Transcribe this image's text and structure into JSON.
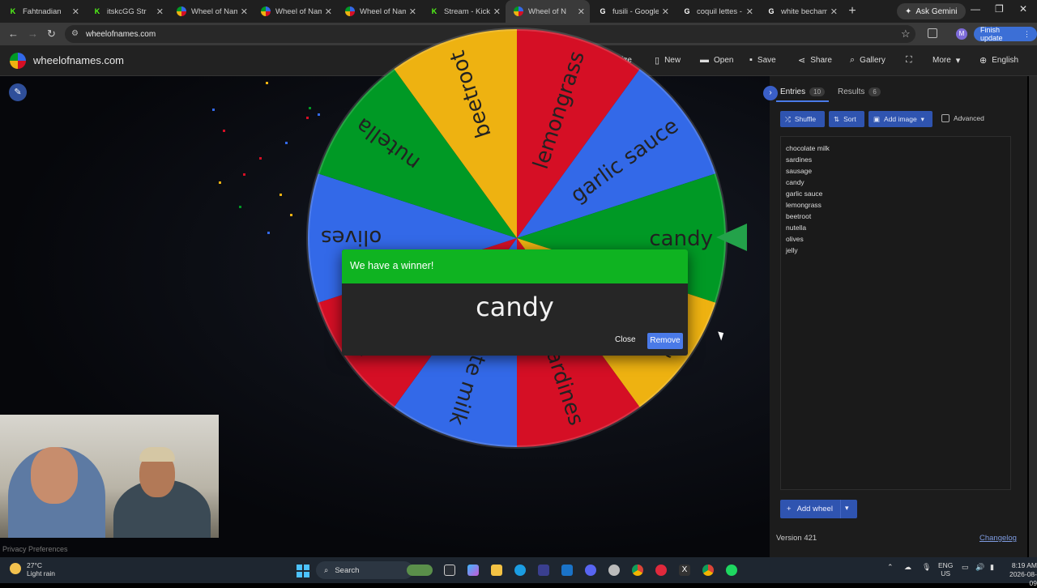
{
  "tabs": [
    {
      "title": "Fahtnadian",
      "fav_color": "#53fc18",
      "fav_text": "K"
    },
    {
      "title": "itskcGG Str",
      "fav_color": "#53fc18",
      "fav_text": "K"
    },
    {
      "title": "Wheel of Name",
      "fav_color": "#e24",
      "fav_text": ""
    },
    {
      "title": "Wheel of Name",
      "fav_color": "#e24",
      "fav_text": ""
    },
    {
      "title": "Wheel of Name",
      "fav_color": "#e24",
      "fav_text": ""
    },
    {
      "title": "Stream - Kick D",
      "fav_color": "#53fc18",
      "fav_text": "K"
    },
    {
      "title": "Wheel of N",
      "fav_color": "#e24",
      "fav_text": ""
    },
    {
      "title": "fusili - Google",
      "fav_color": "#fff",
      "fav_text": "G"
    },
    {
      "title": "coquil lettes - G",
      "fav_color": "#fff",
      "fav_text": "G"
    },
    {
      "title": "white becham",
      "fav_color": "#fff",
      "fav_text": "G"
    }
  ],
  "browser": {
    "ask_gemini": "Ask Gemini",
    "url": "wheelofnames.com",
    "profile_initial": "M",
    "finish_update": "Finish update"
  },
  "app": {
    "site_name": "wheelofnames.com",
    "menu": [
      {
        "label": "Customize",
        "icon": "palette-icon",
        "glyph": "◕"
      },
      {
        "label": "New",
        "icon": "new-file-icon",
        "glyph": "▯"
      },
      {
        "label": "Open",
        "icon": "folder-icon",
        "glyph": "▬"
      },
      {
        "label": "Save",
        "icon": "save-icon",
        "glyph": "▪"
      },
      {
        "label": "Share",
        "icon": "share-icon",
        "glyph": "⋖"
      },
      {
        "label": "Gallery",
        "icon": "search-icon",
        "glyph": "⌕"
      },
      {
        "label": "",
        "icon": "fullscreen-icon",
        "glyph": "⛶"
      },
      {
        "label": "More",
        "icon": "chevron-down-icon",
        "glyph": "▾"
      },
      {
        "label": "English",
        "icon": "globe-icon",
        "glyph": "⊕"
      }
    ]
  },
  "wheel": {
    "segments": [
      {
        "label": "beetroot",
        "color": "#eeb211"
      },
      {
        "label": "lemongrass",
        "color": "#d50f25"
      },
      {
        "label": "garlic sauce",
        "color": "#3369e8"
      },
      {
        "label": "candy",
        "color": "#009925"
      },
      {
        "label": "sausage",
        "color": "#eeb211"
      },
      {
        "label": "sardines",
        "color": "#d50f25"
      },
      {
        "label": "chocolate milk",
        "color": "#3369e8"
      },
      {
        "label": "jelly",
        "color": "#d50f25"
      },
      {
        "label": "olives",
        "color": "#3369e8"
      },
      {
        "label": "nutella",
        "color": "#009925"
      }
    ]
  },
  "dialog": {
    "title": "We have a winner!",
    "winner": "candy",
    "close_label": "Close",
    "remove_label": "Remove"
  },
  "privacy": "Privacy Preferences",
  "panel": {
    "tab_entries": "Entries",
    "entries_count": "10",
    "tab_results": "Results",
    "results_count": "6",
    "shuffle": "Shuffle",
    "sort": "Sort",
    "add_image": "Add image",
    "advanced": "Advanced",
    "entries": [
      "chocolate milk",
      "sardines",
      "sausage",
      "candy",
      "garlic sauce",
      "lemongrass",
      "beetroot",
      "nutella",
      "olives",
      "jelly"
    ],
    "add_wheel": "Add wheel",
    "version": "Version 421",
    "changelog": "Changelog"
  },
  "taskbar": {
    "temp": "27°C",
    "weather": "Light rain",
    "search": "Search",
    "lang_top": "ENG",
    "lang_bottom": "US",
    "time": "8:19 AM",
    "date": "2026-08-09"
  }
}
